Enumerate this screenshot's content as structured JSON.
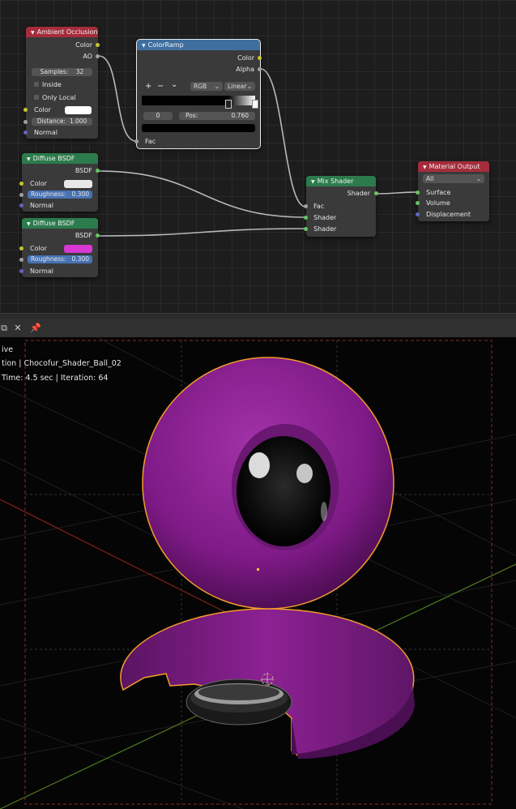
{
  "nodes": {
    "ambient_occlusion": {
      "title": "Ambient Occlusion",
      "out_color": "Color",
      "out_ao": "AO",
      "samples_label": "Samples:",
      "samples_value": "32",
      "inside_label": "Inside",
      "only_local_label": "Only Local",
      "color_label": "Color",
      "distance_label": "Distance:",
      "distance_value": "1.000",
      "normal_label": "Normal"
    },
    "color_ramp": {
      "title": "ColorRamp",
      "out_color": "Color",
      "out_alpha": "Alpha",
      "plus": "+",
      "minus": "−",
      "chevron": "⌄",
      "mode": "RGB",
      "interpolation": "Linear",
      "stop_index": "0",
      "pos_label": "Pos:",
      "pos_value": "0.760",
      "fac_label": "Fac"
    },
    "diffuse_1": {
      "title": "Diffuse BSDF",
      "out_bsdf": "BSDF",
      "color_label": "Color",
      "roughness_label": "Roughness:",
      "roughness_value": "0.300",
      "normal_label": "Normal",
      "color": "#e8e8e8"
    },
    "diffuse_2": {
      "title": "Diffuse BSDF",
      "out_bsdf": "BSDF",
      "color_label": "Color",
      "roughness_label": "Roughness:",
      "roughness_value": "0.300",
      "normal_label": "Normal",
      "color": "#d838d4"
    },
    "mix_shader": {
      "title": "Mix Shader",
      "out_shader": "Shader",
      "fac_label": "Fac",
      "shader1_label": "Shader",
      "shader2_label": "Shader"
    },
    "material_output": {
      "title": "Material Output",
      "target": "All",
      "surface_label": "Surface",
      "volume_label": "Volume",
      "displacement_label": "Displacement"
    }
  },
  "viewport_header": {
    "icons": [
      "copy-icon",
      "close-icon",
      "pin-icon"
    ]
  },
  "viewport": {
    "line1": "ive",
    "line2": "tion | Chocofur_Shader_Ball_02",
    "line3": "Time: 4.5 sec | Iteration: 64"
  },
  "colors": {
    "node_red": "#a52c3b",
    "node_green": "#2c7b4c",
    "node_blue": "#3f6f9f",
    "socket_yellow": "#c7c729",
    "socket_green": "#63c763",
    "socket_purple": "#6363c7",
    "selection_orange": "#f39b2a",
    "ball_purple": "#8a1f92"
  }
}
